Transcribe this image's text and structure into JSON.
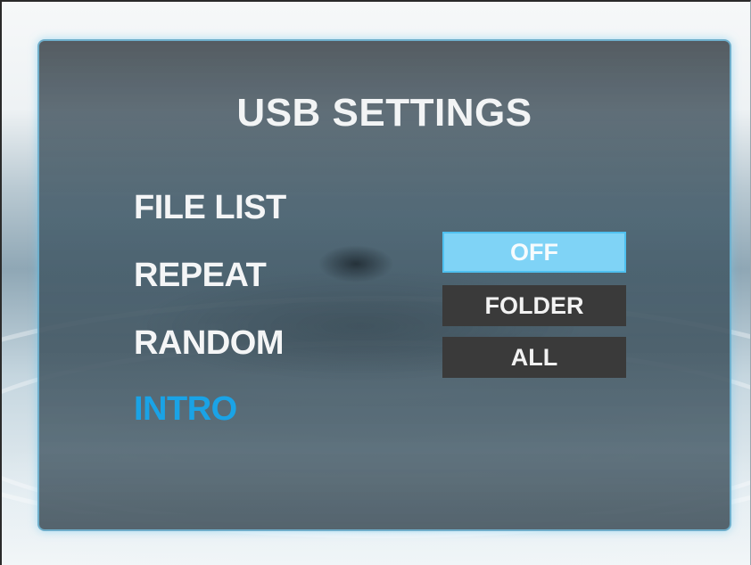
{
  "screen": {
    "title": "USB SETTINGS"
  },
  "menu": {
    "items": [
      {
        "label": "FILE LIST",
        "active": false
      },
      {
        "label": "REPEAT",
        "active": false
      },
      {
        "label": "RANDOM",
        "active": false
      },
      {
        "label": "INTRO",
        "active": true
      }
    ]
  },
  "options": {
    "items": [
      {
        "label": "OFF",
        "selected": true
      },
      {
        "label": "FOLDER",
        "selected": false
      },
      {
        "label": "ALL",
        "selected": false
      }
    ]
  },
  "colors": {
    "accent": "#1aa3e6",
    "selected_option_bg": "#7fd3f6",
    "unselected_option_bg": "#3a3a3a"
  }
}
